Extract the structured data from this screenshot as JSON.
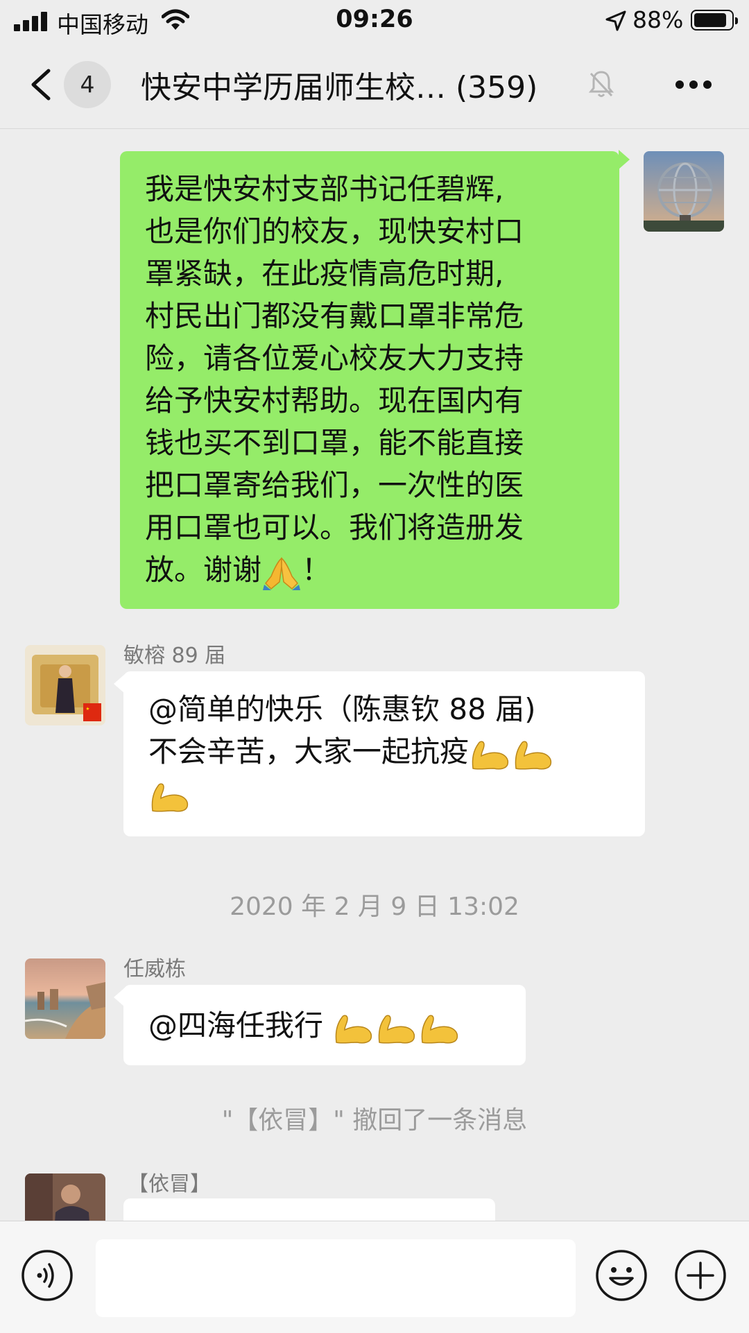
{
  "status_bar": {
    "carrier": "中国移动",
    "time": "09:26",
    "battery_percent": "88%",
    "battery_level": 0.88,
    "icons": [
      "signal-icon",
      "wifi-icon",
      "location-arrow-icon",
      "battery-icon"
    ]
  },
  "nav": {
    "unread_count": "4",
    "title": "快安中学历届师生校… (359)",
    "icons": [
      "back-icon",
      "mute-bell-icon",
      "more-icon"
    ]
  },
  "messages": [
    {
      "side": "right",
      "bubble_color": "#95ec69",
      "avatar": "globe-sculpture-avatar",
      "lines": [
        "我是快安村支部书记任碧辉,",
        "也是你们的校友，现快安村口",
        "罩紧缺，在此疫情高危时期,",
        "村民出门都没有戴口罩非常危",
        "险，请各位爱心校友大力支持",
        "给予快安村帮助。现在国内有",
        "钱也买不到口罩，能不能直接",
        "把口罩寄给我们，一次性的医",
        "用口罩也可以。我们将造册发",
        "放。谢谢"
      ],
      "trailing": "！",
      "emoji": "folded-hands-emoji"
    },
    {
      "side": "left",
      "sender": "敏榕 89 届",
      "avatar": "woman-on-throne-avatar",
      "lines": [
        "@简单的快乐（陈惠钦 88 届)",
        "不会辛苦，大家一起抗疫"
      ],
      "emoji": "flexed-biceps-emoji"
    }
  ],
  "timestamp": "2020 年 2 月 9 日  13:02",
  "messages2": [
    {
      "side": "left",
      "sender": "任威栋",
      "avatar": "coastal-cliffs-avatar",
      "text": "@四海任我行 ",
      "emoji": "flexed-biceps-emoji"
    }
  ],
  "recall_notice": "\"【依冒】\" 撤回了一条消息",
  "messages3": [
    {
      "side": "left",
      "sender": "【依冒】",
      "avatar": "man-portrait-avatar"
    }
  ],
  "input_bar": {
    "placeholder": "",
    "icons": [
      "voice-icon",
      "emoji-icon",
      "plus-icon"
    ]
  }
}
